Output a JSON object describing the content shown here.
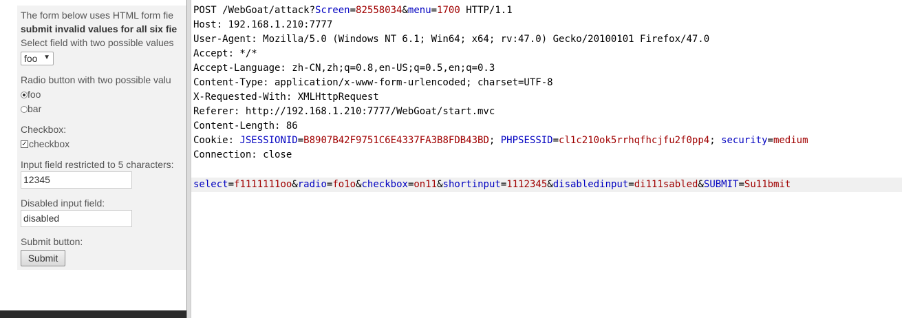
{
  "form": {
    "intro_line": "The form below uses HTML form fie",
    "intro_bold": "submit invalid values for all six fie",
    "select_label": "Select field with two possible values",
    "select_value": "foo",
    "radio_label": "Radio button with two possible valu",
    "radio_options": [
      "foo",
      "bar"
    ],
    "checkbox_label": "Checkbox:",
    "checkbox_text": "checkbox",
    "short_label": "Input field restricted to 5 characters:",
    "short_value": "12345",
    "disabled_label": "Disabled input field:",
    "disabled_value": "disabled",
    "submit_label": "Submit button:",
    "submit_button": "Submit"
  },
  "request": {
    "line1": {
      "prefix": "POST /WebGoat/attack?",
      "p1k": "Screen",
      "eq1": "=",
      "p1v": "82558034",
      "amp": "&",
      "p2k": "menu",
      "eq2": "=",
      "p2v": "1700",
      "suffix": " HTTP/1.1"
    },
    "host": "Host: 192.168.1.210:7777",
    "user_agent": "User-Agent: Mozilla/5.0 (Windows NT 6.1; Win64; x64; rv:47.0) Gecko/20100101 Firefox/47.0",
    "accept": "Accept: */*",
    "accept_language": "Accept-Language: zh-CN,zh;q=0.8,en-US;q=0.5,en;q=0.3",
    "content_type": "Content-Type: application/x-www-form-urlencoded; charset=UTF-8",
    "x_requested_with": "X-Requested-With: XMLHttpRequest",
    "referer": "Referer: http://192.168.1.210:7777/WebGoat/start.mvc",
    "content_length": "Content-Length: 86",
    "cookie": {
      "prefix": "Cookie: ",
      "c1k": "JSESSIONID",
      "c1v": "B8907B42F9751C6E4337FA3B8FDB43BD",
      "c2k": "PHPSESSID",
      "c2v": "cl1c210ok5rrhqfhcjfu2f0pp4",
      "c3k": "security",
      "c3v": "medium",
      "sep": "; ",
      "eq": "="
    },
    "connection": "Connection: close",
    "body": [
      {
        "k": "select",
        "v": "f1111111oo"
      },
      {
        "k": "radio",
        "v": "fo1o"
      },
      {
        "k": "checkbox",
        "v": "on11"
      },
      {
        "k": "shortinput",
        "v": "1112345"
      },
      {
        "k": "disabledinput",
        "v": "di111sabled"
      },
      {
        "k": "SUBMIT",
        "v": "Su11bmit"
      }
    ],
    "body_eq": "=",
    "body_amp": "&"
  }
}
